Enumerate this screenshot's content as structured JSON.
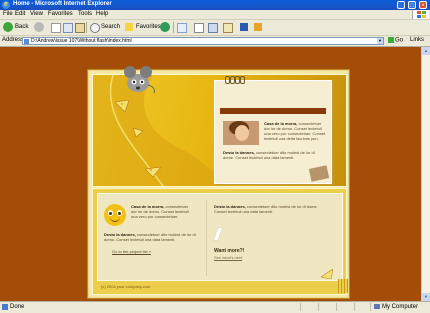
{
  "window": {
    "title": "Home - Microsoft Internet Explorer",
    "minimize": "_",
    "maximize": "□",
    "close": "×"
  },
  "menu": [
    "File",
    "Edit",
    "View",
    "Favorites",
    "Tools",
    "Help"
  ],
  "toolbar": {
    "back": "Back",
    "search": "Search",
    "favorites": "Favorites"
  },
  "address": {
    "label": "Address",
    "url": "D:\\Andrew\\issue 107\\Without flash\\index.html",
    "go": "Go",
    "links": "Links"
  },
  "page": {
    "card": {
      "title_bold": "Casa de la morra,",
      "title_rest": " consectetuer dor lor de domo. Conset lectetuil una vero por consectetuer. Conset lectetuil una delta lacrimis pun.",
      "body_bold": "Desto la dannes,",
      "body_rest": " consectetuer dito molest de lor di dome. Conset lectetuil una data lamenti."
    },
    "bottom": {
      "text1_bold": "Casa de la morra,",
      "text1_rest": " consectetuer dor lor de domo. Conset lectetuil una vero por consectetuer.",
      "text2_bold": "Desto la dannes,",
      "text2_rest": " consectetuer dito molest de lor di domo. Conset lectetuil una data lamenti.",
      "link": "Go to the project list",
      "text3_bold": "Desto la dannes,",
      "text3_rest": " consectetuer dito molest de lor di dome. Conset lectetuil una data lamenti.",
      "want_more": "Want more?!",
      "see_more": "See what's next",
      "copyright": "(c) 2004 your company.com"
    }
  },
  "status": {
    "text": "Done",
    "zone": "My Computer"
  },
  "colors": {
    "page_bg": "#a34d08",
    "accent_yellow": "#e7b612",
    "card_bar": "#8a3a08"
  }
}
